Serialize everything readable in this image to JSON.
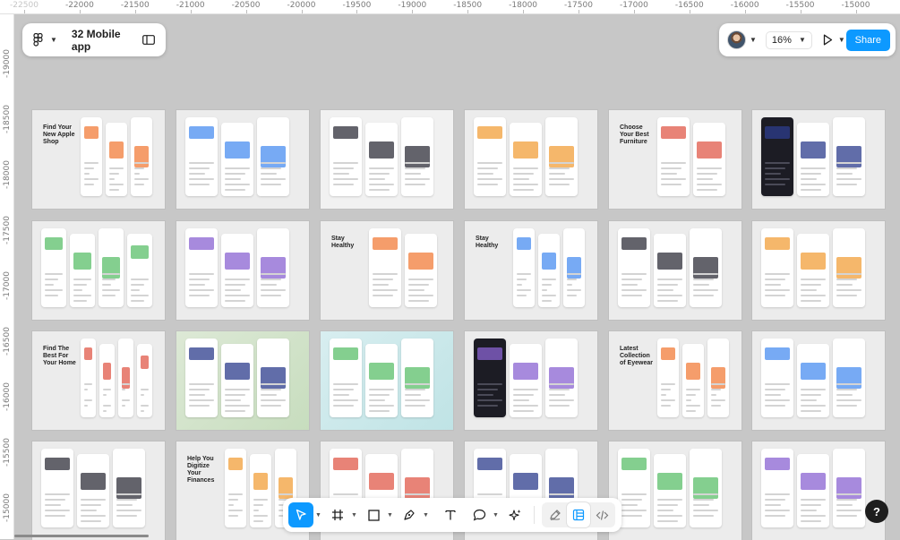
{
  "file": {
    "title": "32 Mobile app"
  },
  "ruler": {
    "top": [
      "-22500",
      "-22000",
      "-21500",
      "-21000",
      "-20500",
      "-20000",
      "-19500",
      "-19000",
      "-18500",
      "-18000",
      "-17500",
      "-17000",
      "-16500",
      "-16000",
      "-15500",
      "-15000"
    ],
    "left": [
      "-19000",
      "-18500",
      "-18000",
      "-17500",
      "-17000",
      "-16500",
      "-16000",
      "-15500",
      "-15000"
    ]
  },
  "topbar": {
    "zoom": "16%",
    "share_label": "Share"
  },
  "help": {
    "label": "?"
  },
  "frames": [
    {
      "style": "light",
      "headline": "Find Your New Apple Shop",
      "phones": 3
    },
    {
      "style": "light",
      "headline": "",
      "phones": 3
    },
    {
      "style": "pale",
      "headline": "",
      "phones": 3
    },
    {
      "style": "light",
      "headline": "",
      "phones": 3
    },
    {
      "style": "light",
      "headline": "Choose Your Best Furniture",
      "phones": 2
    },
    {
      "style": "light",
      "headline": "",
      "phones": 3,
      "dark": 0
    },
    {
      "style": "light",
      "headline": "",
      "phones": 4
    },
    {
      "style": "light",
      "headline": "",
      "phones": 3
    },
    {
      "style": "light",
      "headline": "Stay Healthy",
      "phones": 2
    },
    {
      "style": "light",
      "headline": "Stay Healthy",
      "phones": 3
    },
    {
      "style": "light",
      "headline": "",
      "phones": 3
    },
    {
      "style": "light",
      "headline": "",
      "phones": 3
    },
    {
      "style": "light",
      "headline": "Find The Best For Your Home",
      "phones": 4
    },
    {
      "style": "green",
      "headline": "",
      "phones": 3
    },
    {
      "style": "teal",
      "headline": "",
      "phones": 3
    },
    {
      "style": "light",
      "headline": "",
      "phones": 3,
      "dark": 0
    },
    {
      "style": "light",
      "headline": "Latest Collection of Eyewear",
      "phones": 3
    },
    {
      "style": "light",
      "headline": "",
      "phones": 3
    },
    {
      "style": "light",
      "headline": "",
      "phones": 3
    },
    {
      "style": "light",
      "headline": "Help You Digitize Your Finances",
      "phones": 3
    },
    {
      "style": "light",
      "headline": "",
      "phones": 3
    },
    {
      "style": "light",
      "headline": "",
      "phones": 3
    },
    {
      "style": "light",
      "headline": "",
      "phones": 3
    },
    {
      "style": "light",
      "headline": "",
      "phones": 3
    }
  ],
  "toolbar": {
    "tools": [
      "move-tool",
      "frame-tool",
      "shape-tool",
      "pen-tool",
      "text-tool",
      "comment-tool",
      "actions-tool"
    ],
    "dev": [
      "draw-mode",
      "design-mode",
      "dev-mode"
    ]
  }
}
